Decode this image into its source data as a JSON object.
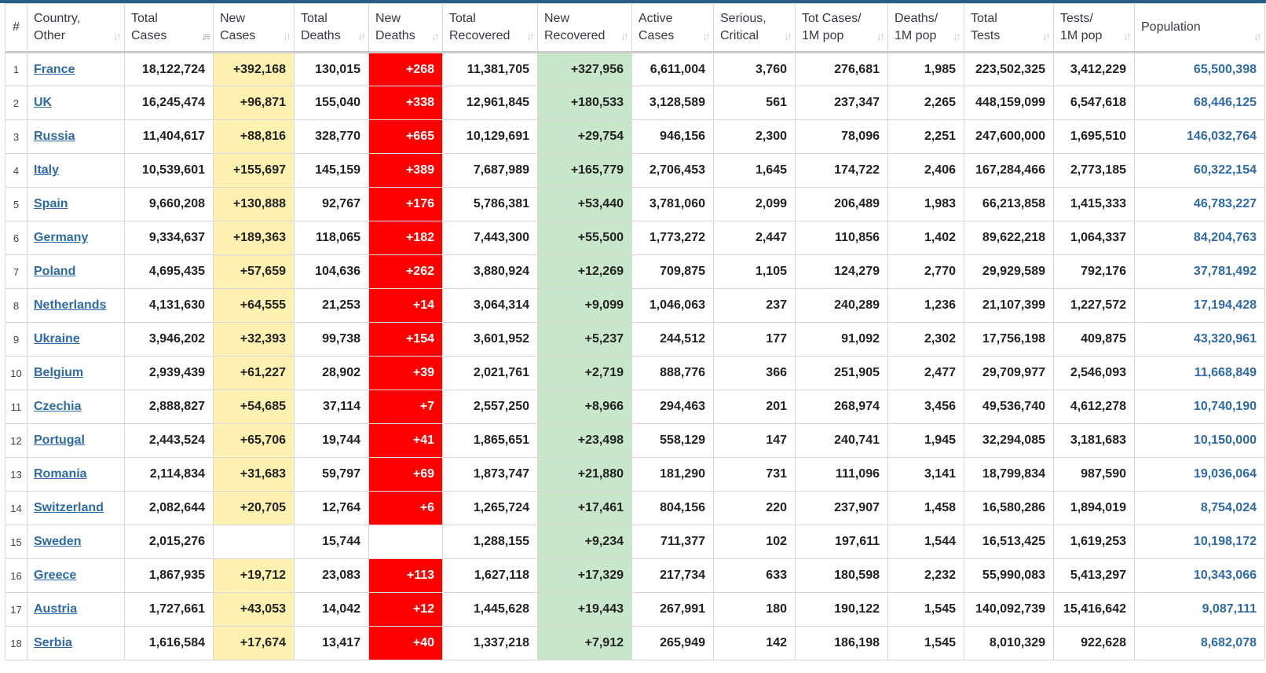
{
  "headers": [
    {
      "key": "rank",
      "lines": [
        "#"
      ],
      "sortable": false
    },
    {
      "key": "country",
      "lines": [
        "Country,",
        "Other"
      ],
      "sortable": true
    },
    {
      "key": "total_cases",
      "lines": [
        "Total",
        "Cases"
      ],
      "sortable": true,
      "active_sort": true
    },
    {
      "key": "new_cases",
      "lines": [
        "New",
        "Cases"
      ],
      "sortable": true
    },
    {
      "key": "total_deaths",
      "lines": [
        "Total",
        "Deaths"
      ],
      "sortable": true
    },
    {
      "key": "new_deaths",
      "lines": [
        "New",
        "Deaths"
      ],
      "sortable": true
    },
    {
      "key": "total_recovered",
      "lines": [
        "Total",
        "Recovered"
      ],
      "sortable": true
    },
    {
      "key": "new_recovered",
      "lines": [
        "New",
        "Recovered"
      ],
      "sortable": true
    },
    {
      "key": "active_cases",
      "lines": [
        "Active",
        "Cases"
      ],
      "sortable": true
    },
    {
      "key": "serious",
      "lines": [
        "Serious,",
        "Critical"
      ],
      "sortable": true
    },
    {
      "key": "cases_per_1m",
      "lines": [
        "Tot Cases/",
        "1M pop"
      ],
      "sortable": true
    },
    {
      "key": "deaths_per_1m",
      "lines": [
        "Deaths/",
        "1M pop"
      ],
      "sortable": true
    },
    {
      "key": "total_tests",
      "lines": [
        "Total",
        "Tests"
      ],
      "sortable": true
    },
    {
      "key": "tests_per_1m",
      "lines": [
        "Tests/",
        "1M pop"
      ],
      "sortable": true
    },
    {
      "key": "population",
      "lines": [
        "Population"
      ],
      "sortable": true
    }
  ],
  "icons": {
    "sort_glyph": "↓↑",
    "sort_active_glyph": "↓≡"
  },
  "colors": {
    "new_cases_bg": "#fff1b0",
    "new_deaths_bg": "#ff0000",
    "new_recovered_bg": "#c8e6c9",
    "link": "#2e6aa7",
    "top_border": "#2a5d84"
  },
  "rows": [
    {
      "rank": "1",
      "country": "France",
      "total_cases": "18,122,724",
      "new_cases": "+392,168",
      "total_deaths": "130,015",
      "new_deaths": "+268",
      "total_recovered": "11,381,705",
      "new_recovered": "+327,956",
      "active_cases": "6,611,004",
      "serious": "3,760",
      "cases_per_1m": "276,681",
      "deaths_per_1m": "1,985",
      "total_tests": "223,502,325",
      "tests_per_1m": "3,412,229",
      "population": "65,500,398"
    },
    {
      "rank": "2",
      "country": "UK",
      "total_cases": "16,245,474",
      "new_cases": "+96,871",
      "total_deaths": "155,040",
      "new_deaths": "+338",
      "total_recovered": "12,961,845",
      "new_recovered": "+180,533",
      "active_cases": "3,128,589",
      "serious": "561",
      "cases_per_1m": "237,347",
      "deaths_per_1m": "2,265",
      "total_tests": "448,159,099",
      "tests_per_1m": "6,547,618",
      "population": "68,446,125"
    },
    {
      "rank": "3",
      "country": "Russia",
      "total_cases": "11,404,617",
      "new_cases": "+88,816",
      "total_deaths": "328,770",
      "new_deaths": "+665",
      "total_recovered": "10,129,691",
      "new_recovered": "+29,754",
      "active_cases": "946,156",
      "serious": "2,300",
      "cases_per_1m": "78,096",
      "deaths_per_1m": "2,251",
      "total_tests": "247,600,000",
      "tests_per_1m": "1,695,510",
      "population": "146,032,764"
    },
    {
      "rank": "4",
      "country": "Italy",
      "total_cases": "10,539,601",
      "new_cases": "+155,697",
      "total_deaths": "145,159",
      "new_deaths": "+389",
      "total_recovered": "7,687,989",
      "new_recovered": "+165,779",
      "active_cases": "2,706,453",
      "serious": "1,645",
      "cases_per_1m": "174,722",
      "deaths_per_1m": "2,406",
      "total_tests": "167,284,466",
      "tests_per_1m": "2,773,185",
      "population": "60,322,154"
    },
    {
      "rank": "5",
      "country": "Spain",
      "total_cases": "9,660,208",
      "new_cases": "+130,888",
      "total_deaths": "92,767",
      "new_deaths": "+176",
      "total_recovered": "5,786,381",
      "new_recovered": "+53,440",
      "active_cases": "3,781,060",
      "serious": "2,099",
      "cases_per_1m": "206,489",
      "deaths_per_1m": "1,983",
      "total_tests": "66,213,858",
      "tests_per_1m": "1,415,333",
      "population": "46,783,227"
    },
    {
      "rank": "6",
      "country": "Germany",
      "total_cases": "9,334,637",
      "new_cases": "+189,363",
      "total_deaths": "118,065",
      "new_deaths": "+182",
      "total_recovered": "7,443,300",
      "new_recovered": "+55,500",
      "active_cases": "1,773,272",
      "serious": "2,447",
      "cases_per_1m": "110,856",
      "deaths_per_1m": "1,402",
      "total_tests": "89,622,218",
      "tests_per_1m": "1,064,337",
      "population": "84,204,763"
    },
    {
      "rank": "7",
      "country": "Poland",
      "total_cases": "4,695,435",
      "new_cases": "+57,659",
      "total_deaths": "104,636",
      "new_deaths": "+262",
      "total_recovered": "3,880,924",
      "new_recovered": "+12,269",
      "active_cases": "709,875",
      "serious": "1,105",
      "cases_per_1m": "124,279",
      "deaths_per_1m": "2,770",
      "total_tests": "29,929,589",
      "tests_per_1m": "792,176",
      "population": "37,781,492"
    },
    {
      "rank": "8",
      "country": "Netherlands",
      "total_cases": "4,131,630",
      "new_cases": "+64,555",
      "total_deaths": "21,253",
      "new_deaths": "+14",
      "total_recovered": "3,064,314",
      "new_recovered": "+9,099",
      "active_cases": "1,046,063",
      "serious": "237",
      "cases_per_1m": "240,289",
      "deaths_per_1m": "1,236",
      "total_tests": "21,107,399",
      "tests_per_1m": "1,227,572",
      "population": "17,194,428"
    },
    {
      "rank": "9",
      "country": "Ukraine",
      "total_cases": "3,946,202",
      "new_cases": "+32,393",
      "total_deaths": "99,738",
      "new_deaths": "+154",
      "total_recovered": "3,601,952",
      "new_recovered": "+5,237",
      "active_cases": "244,512",
      "serious": "177",
      "cases_per_1m": "91,092",
      "deaths_per_1m": "2,302",
      "total_tests": "17,756,198",
      "tests_per_1m": "409,875",
      "population": "43,320,961"
    },
    {
      "rank": "10",
      "country": "Belgium",
      "total_cases": "2,939,439",
      "new_cases": "+61,227",
      "total_deaths": "28,902",
      "new_deaths": "+39",
      "total_recovered": "2,021,761",
      "new_recovered": "+2,719",
      "active_cases": "888,776",
      "serious": "366",
      "cases_per_1m": "251,905",
      "deaths_per_1m": "2,477",
      "total_tests": "29,709,977",
      "tests_per_1m": "2,546,093",
      "population": "11,668,849"
    },
    {
      "rank": "11",
      "country": "Czechia",
      "total_cases": "2,888,827",
      "new_cases": "+54,685",
      "total_deaths": "37,114",
      "new_deaths": "+7",
      "total_recovered": "2,557,250",
      "new_recovered": "+8,966",
      "active_cases": "294,463",
      "serious": "201",
      "cases_per_1m": "268,974",
      "deaths_per_1m": "3,456",
      "total_tests": "49,536,740",
      "tests_per_1m": "4,612,278",
      "population": "10,740,190"
    },
    {
      "rank": "12",
      "country": "Portugal",
      "total_cases": "2,443,524",
      "new_cases": "+65,706",
      "total_deaths": "19,744",
      "new_deaths": "+41",
      "total_recovered": "1,865,651",
      "new_recovered": "+23,498",
      "active_cases": "558,129",
      "serious": "147",
      "cases_per_1m": "240,741",
      "deaths_per_1m": "1,945",
      "total_tests": "32,294,085",
      "tests_per_1m": "3,181,683",
      "population": "10,150,000"
    },
    {
      "rank": "13",
      "country": "Romania",
      "total_cases": "2,114,834",
      "new_cases": "+31,683",
      "total_deaths": "59,797",
      "new_deaths": "+69",
      "total_recovered": "1,873,747",
      "new_recovered": "+21,880",
      "active_cases": "181,290",
      "serious": "731",
      "cases_per_1m": "111,096",
      "deaths_per_1m": "3,141",
      "total_tests": "18,799,834",
      "tests_per_1m": "987,590",
      "population": "19,036,064"
    },
    {
      "rank": "14",
      "country": "Switzerland",
      "total_cases": "2,082,644",
      "new_cases": "+20,705",
      "total_deaths": "12,764",
      "new_deaths": "+6",
      "total_recovered": "1,265,724",
      "new_recovered": "+17,461",
      "active_cases": "804,156",
      "serious": "220",
      "cases_per_1m": "237,907",
      "deaths_per_1m": "1,458",
      "total_tests": "16,580,286",
      "tests_per_1m": "1,894,019",
      "population": "8,754,024"
    },
    {
      "rank": "15",
      "country": "Sweden",
      "total_cases": "2,015,276",
      "new_cases": "",
      "total_deaths": "15,744",
      "new_deaths": "",
      "total_recovered": "1,288,155",
      "new_recovered": "+9,234",
      "active_cases": "711,377",
      "serious": "102",
      "cases_per_1m": "197,611",
      "deaths_per_1m": "1,544",
      "total_tests": "16,513,425",
      "tests_per_1m": "1,619,253",
      "population": "10,198,172"
    },
    {
      "rank": "16",
      "country": "Greece",
      "total_cases": "1,867,935",
      "new_cases": "+19,712",
      "total_deaths": "23,083",
      "new_deaths": "+113",
      "total_recovered": "1,627,118",
      "new_recovered": "+17,329",
      "active_cases": "217,734",
      "serious": "633",
      "cases_per_1m": "180,598",
      "deaths_per_1m": "2,232",
      "total_tests": "55,990,083",
      "tests_per_1m": "5,413,297",
      "population": "10,343,066"
    },
    {
      "rank": "17",
      "country": "Austria",
      "total_cases": "1,727,661",
      "new_cases": "+43,053",
      "total_deaths": "14,042",
      "new_deaths": "+12",
      "total_recovered": "1,445,628",
      "new_recovered": "+19,443",
      "active_cases": "267,991",
      "serious": "180",
      "cases_per_1m": "190,122",
      "deaths_per_1m": "1,545",
      "total_tests": "140,092,739",
      "tests_per_1m": "15,416,642",
      "population": "9,087,111"
    },
    {
      "rank": "18",
      "country": "Serbia",
      "total_cases": "1,616,584",
      "new_cases": "+17,674",
      "total_deaths": "13,417",
      "new_deaths": "+40",
      "total_recovered": "1,337,218",
      "new_recovered": "+7,912",
      "active_cases": "265,949",
      "serious": "142",
      "cases_per_1m": "186,198",
      "deaths_per_1m": "1,545",
      "total_tests": "8,010,329",
      "tests_per_1m": "922,628",
      "population": "8,682,078"
    }
  ]
}
